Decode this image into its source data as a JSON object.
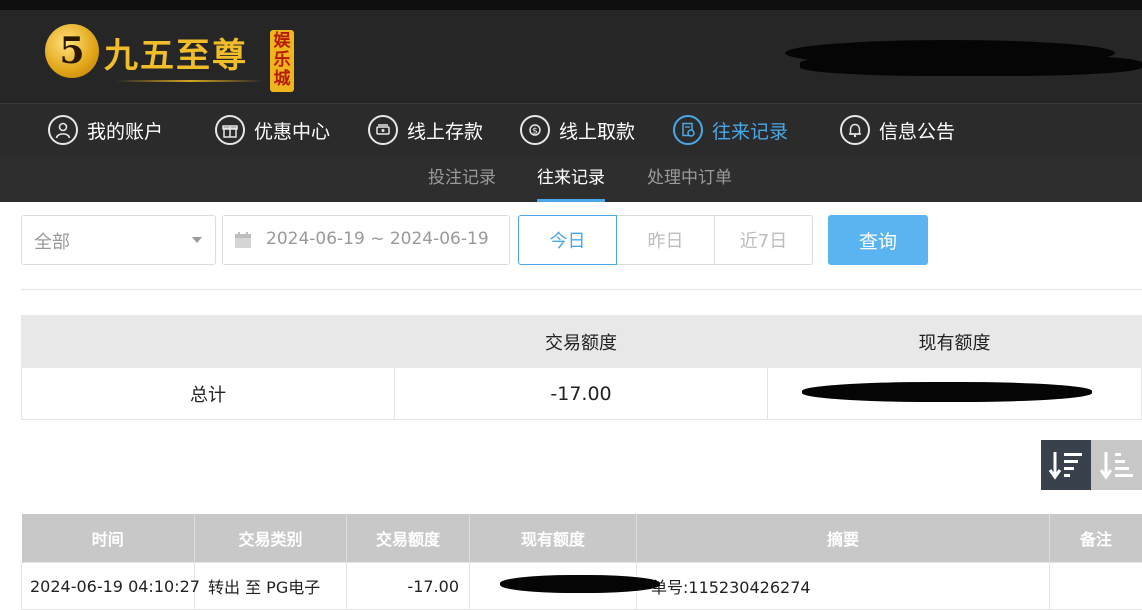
{
  "header": {
    "logo_mark": "5",
    "logo_text": "九五至尊",
    "logo_badge": "娱乐城"
  },
  "nav": {
    "items": [
      {
        "label": "我的账户"
      },
      {
        "label": "优惠中心"
      },
      {
        "label": "线上存款"
      },
      {
        "label": "线上取款"
      },
      {
        "label": "往来记录",
        "active": true
      },
      {
        "label": "信息公告"
      }
    ]
  },
  "subnav": {
    "tabs": [
      {
        "label": "投注记录"
      },
      {
        "label": "往来记录",
        "active": true
      },
      {
        "label": "处理中订单"
      }
    ]
  },
  "filters": {
    "type_select": "全部",
    "date_range": "2024-06-19 ~ 2024-06-19",
    "quick_ranges": [
      "今日",
      "昨日",
      "近7日"
    ],
    "selected_range": "今日",
    "query_label": "查询"
  },
  "summary": {
    "col_amount": "交易额度",
    "col_balance": "现有额度",
    "total_label": "总计",
    "total_amount": "-17.00"
  },
  "records": {
    "columns": [
      "时间",
      "交易类别",
      "交易额度",
      "现有额度",
      "摘要",
      "备注"
    ],
    "rows": [
      {
        "time": "2024-06-19 04:10:27",
        "type": "转出 至 PG电子",
        "amount": "-17.00",
        "summary": "单号:115230426274",
        "note": ""
      }
    ]
  },
  "colors": {
    "accent": "#4aa8e8",
    "query_button": "#5ab4f2",
    "header_bg": "#262626",
    "gold": "#f1bd2a"
  }
}
